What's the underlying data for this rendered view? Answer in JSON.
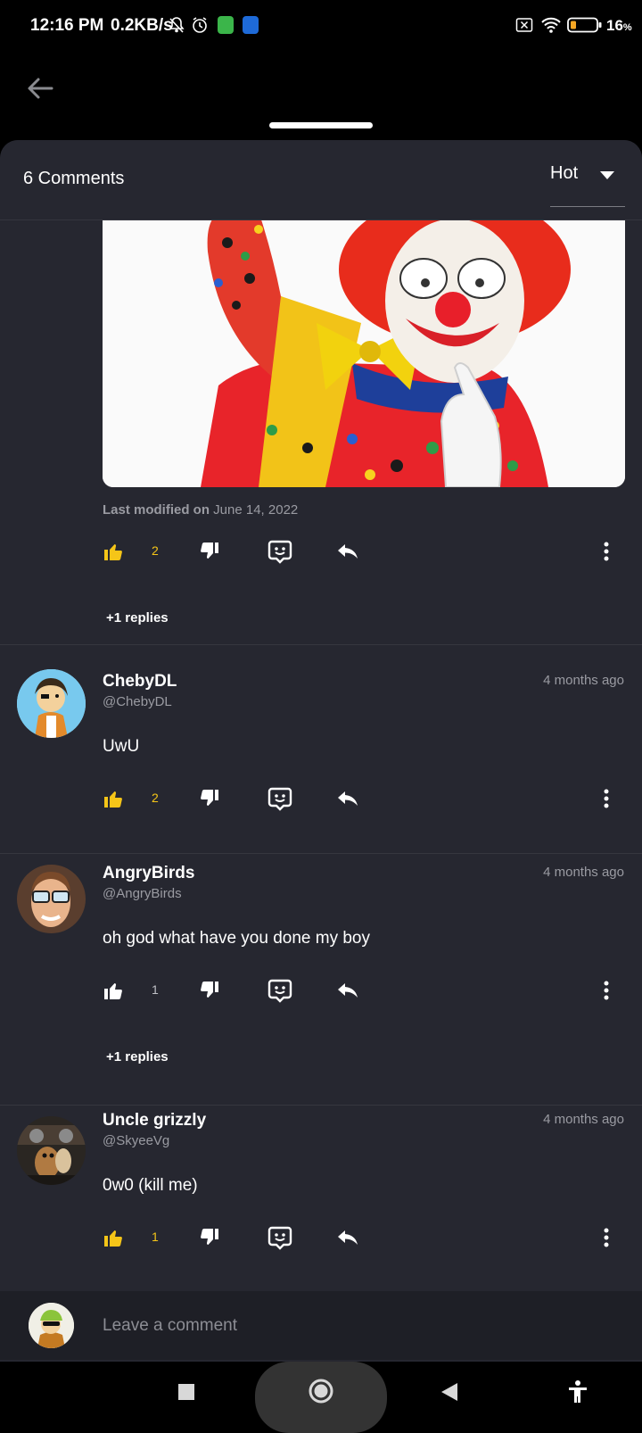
{
  "status_bar": {
    "time": "12:16 PM",
    "speed": "0.2KB/s",
    "battery": "16",
    "battery_unit": "%"
  },
  "header": {
    "comments_count": "6 Comments",
    "sort_value": "Hot"
  },
  "post": {
    "last_modified_label": "Last modified on",
    "last_modified_date": "June 14, 2022",
    "likes": "2",
    "replies": "+1 replies"
  },
  "comments": [
    {
      "name": "ChebyDL",
      "handle": "@ChebyDL",
      "time": "4 months ago",
      "text": "UwU",
      "likes": "2",
      "liked": true
    },
    {
      "name": "AngryBirds",
      "handle": "@AngryBirds",
      "time": "4 months ago",
      "text": "oh god what have you done my boy",
      "likes": "1",
      "liked": false,
      "replies": "+1 replies"
    },
    {
      "name": "Uncle grizzly",
      "handle": "@SkyeeVg",
      "time": "4 months ago",
      "text": "0w0 (kill me)",
      "likes": "1",
      "liked": true
    }
  ],
  "composer": {
    "placeholder": "Leave a comment"
  },
  "colors": {
    "sheet": "#262730",
    "like_active": "#f5c518",
    "muted": "#9a9ba2"
  },
  "icons": [
    "back-arrow-icon",
    "thumbs-up-icon",
    "thumbs-down-icon",
    "emoji-reaction-icon",
    "reply-icon",
    "more-vert-icon",
    "stop-square-icon",
    "home-circle-icon",
    "back-triangle-icon",
    "accessibility-icon"
  ]
}
